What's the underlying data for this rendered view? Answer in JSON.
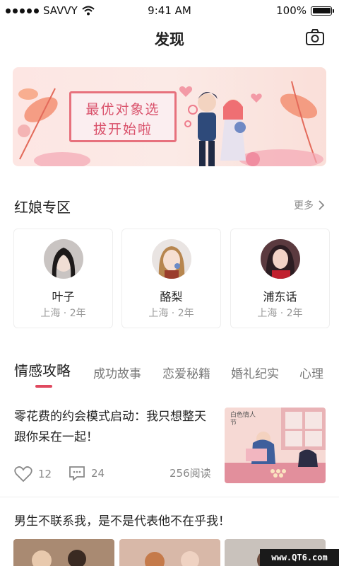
{
  "status_bar": {
    "carrier": "SAVVY",
    "time": "9:41 AM",
    "battery_text": "100%",
    "battery_level": 1.0
  },
  "header": {
    "title": "发现",
    "camera_icon": "camera-icon"
  },
  "banner": {
    "line1": "最优对象选",
    "line2": "拔开始啦"
  },
  "matchmaker": {
    "title": "红娘专区",
    "more_label": "更多",
    "cards": [
      {
        "name": "叶子",
        "meta": "上海 · 2年"
      },
      {
        "name": "酪梨",
        "meta": "上海 · 2年"
      },
      {
        "name": "浦东话",
        "meta": "上海 · 2年"
      }
    ]
  },
  "tabs": [
    {
      "label": "情感攻略",
      "active": true
    },
    {
      "label": "成功故事",
      "active": false
    },
    {
      "label": "恋爱秘籍",
      "active": false
    },
    {
      "label": "婚礼纪实",
      "active": false
    },
    {
      "label": "心理",
      "active": false
    }
  ],
  "article": {
    "title": "零花费的约会模式启动：我只想整天跟你呆在一起！",
    "likes": "12",
    "comments": "24",
    "reads": "256阅读",
    "image_caption": "白色情人节"
  },
  "article2": {
    "title": "男生不联系我，是不是代表他不在乎我！"
  },
  "watermark": "www.QT6.com",
  "colors": {
    "accent": "#e0495f",
    "banner_text": "#d9506a"
  }
}
